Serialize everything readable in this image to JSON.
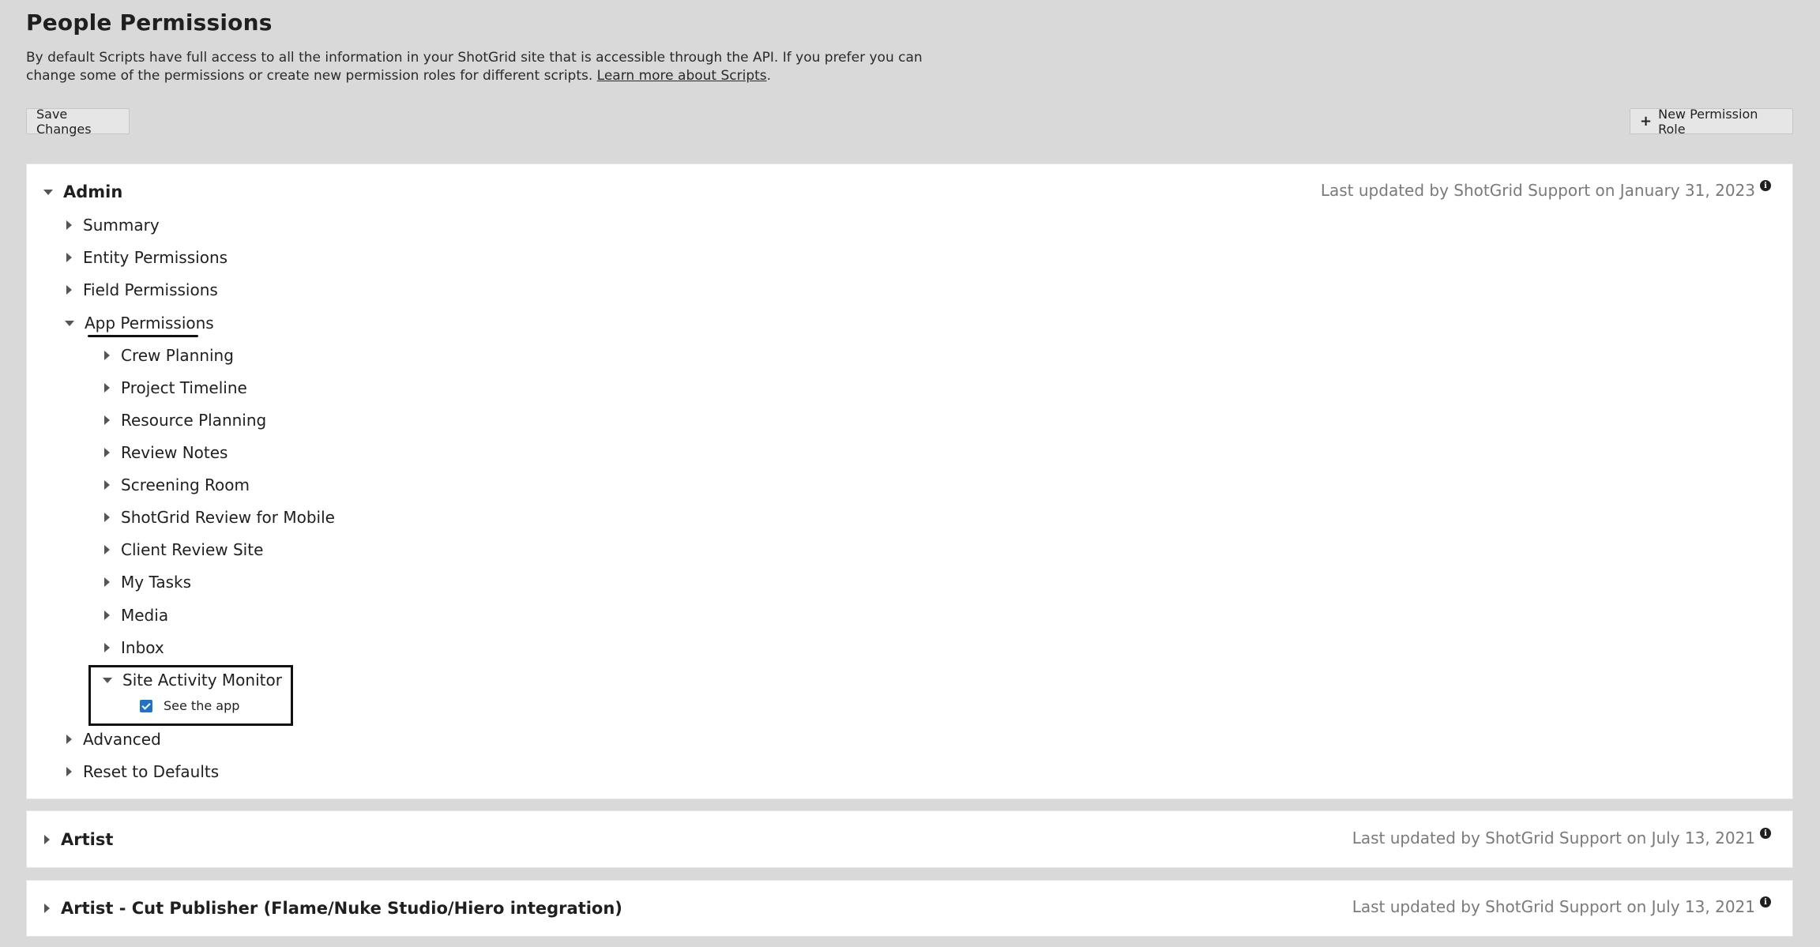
{
  "page": {
    "title": "People Permissions",
    "intro_text": "By default Scripts have full access to all the information in your ShotGrid site that is accessible through the API. If you prefer you can change some of the permissions or create new permission roles for different scripts. ",
    "intro_link": "Learn more about Scripts",
    "intro_end": "."
  },
  "toolbar": {
    "save_label": "Save Changes",
    "new_role_icon": "+",
    "new_role_label": "New Permission Role"
  },
  "roles": [
    {
      "name": "Admin",
      "expanded": true,
      "updated": "Last updated by ShotGrid Support on January 31, 2023",
      "sections": [
        "Summary",
        "Entity Permissions",
        "Field Permissions",
        "App Permissions",
        "Advanced",
        "Reset to Defaults"
      ],
      "apps": [
        "Crew Planning",
        "Project Timeline",
        "Resource Planning",
        "Review Notes",
        "Screening Room",
        "ShotGrid Review for Mobile",
        "Client Review Site",
        "My Tasks",
        "Media",
        "Inbox",
        "Site Activity Monitor"
      ],
      "site_activity_option": {
        "label": "See the app",
        "checked": true
      }
    },
    {
      "name": "Artist",
      "expanded": false,
      "updated": "Last updated by ShotGrid Support on July 13, 2021"
    },
    {
      "name": "Artist - Cut Publisher (Flame/Nuke Studio/Hiero integration)",
      "expanded": false,
      "updated": "Last updated by ShotGrid Support on July 13, 2021"
    }
  ],
  "icons": {
    "expanded": "triangle-down-icon",
    "collapsed": "triangle-right-icon",
    "info": "info-icon"
  },
  "colors": {
    "background": "#d9d9d9",
    "panel": "#ffffff",
    "checkbox": "#1e73c8",
    "muted_text": "#7a7a7a"
  }
}
